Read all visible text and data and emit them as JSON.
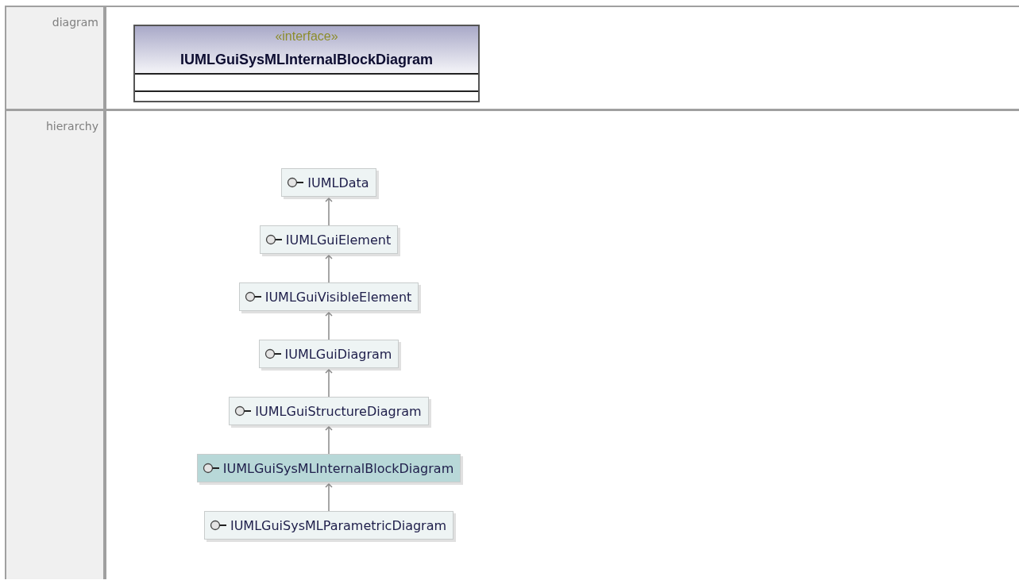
{
  "sections": [
    {
      "kind": "diagram",
      "label": "diagram",
      "classifier": {
        "stereotype": "«interface»",
        "name": "IUMLGuiSysMLInternalBlockDiagram"
      }
    },
    {
      "kind": "hierarchy",
      "label": "hierarchy",
      "nodes": [
        {
          "name": "IUMLData",
          "selected": false
        },
        {
          "name": "IUMLGuiElement",
          "selected": false
        },
        {
          "name": "IUMLGuiVisibleElement",
          "selected": false
        },
        {
          "name": "IUMLGuiDiagram",
          "selected": false
        },
        {
          "name": "IUMLGuiStructureDiagram",
          "selected": false
        },
        {
          "name": "IUMLGuiSysMLInternalBlockDiagram",
          "selected": true
        },
        {
          "name": "IUMLGuiSysMLParametricDiagram",
          "selected": false
        }
      ]
    }
  ]
}
